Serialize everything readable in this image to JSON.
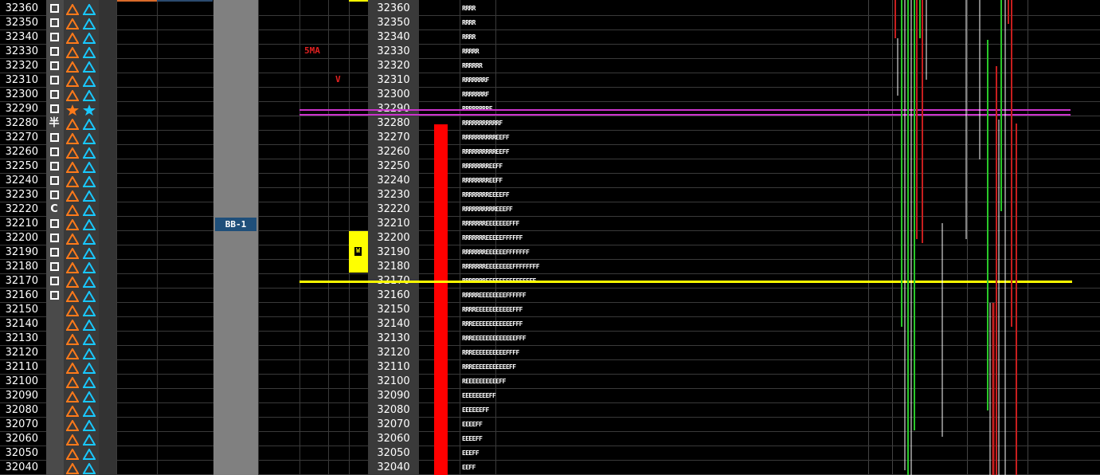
{
  "ladder": {
    "prices": [
      "32360",
      "32350",
      "32340",
      "32330",
      "32320",
      "32310",
      "32300",
      "32290",
      "32280",
      "32270",
      "32260",
      "32250",
      "32240",
      "32230",
      "32220",
      "32210",
      "32200",
      "32190",
      "32180",
      "32170",
      "32160",
      "32150",
      "32140",
      "32130",
      "32120",
      "32110",
      "32100",
      "32090",
      "32080",
      "32070",
      "32060",
      "32050",
      "32040"
    ],
    "col1_marks": [
      "box",
      "box",
      "box",
      "box",
      "box",
      "box",
      "box",
      "box",
      "kanji",
      "box",
      "box",
      "box",
      "box",
      "box",
      "C",
      "box",
      "box",
      "box",
      "box",
      "box",
      "box",
      "",
      "",
      "",
      "",
      "",
      "",
      "",
      "",
      "",
      "",
      "",
      ""
    ],
    "col2_marks": [
      "tri",
      "tri",
      "tri",
      "tri",
      "tri",
      "tri",
      "tri",
      "star",
      "tri",
      "tri",
      "tri",
      "tri",
      "tri",
      "tri",
      "tri",
      "tri",
      "tri",
      "tri",
      "tri",
      "tri",
      "tri",
      "tri",
      "tri",
      "tri",
      "tri",
      "tri",
      "tri",
      "tri",
      "tri",
      "tri",
      "tri",
      "tri",
      "tri"
    ],
    "col3_marks": [
      "tri",
      "tri",
      "tri",
      "tri",
      "tri",
      "tri",
      "tri",
      "star",
      "tri",
      "tri",
      "tri",
      "tri",
      "tri",
      "tri",
      "tri",
      "tri",
      "tri",
      "tri",
      "tri",
      "tri",
      "tri",
      "tri",
      "tri",
      "tri",
      "tri",
      "tri",
      "tri",
      "tri",
      "tri",
      "tri",
      "tri",
      "tri",
      "tri"
    ],
    "kanji_text": "半",
    "c_text": "C"
  },
  "tpo_profile": [
    "RRRR",
    "RRRR",
    "RRRR",
    "RRRRR",
    "RRRRRR",
    "RRRRRRRF",
    "RRRRRRRF",
    "RRRRRRRRF",
    "RRRRRRRRRRRF",
    "RRRRRRRRRREEFF",
    "RRRRRRRRRREEFF",
    "RRRRRRRREEFF",
    "RRRRRRRREEFF",
    "RRRRRRRREEEEFF",
    "RRRRRRRRRREEEFF",
    "RRRRRRREEEEEEEFFF",
    "RRRRRRREEEEEFFFFFF",
    "RRRRRRREEEEEEFFFFFFF",
    "RRRRRRREEEEEEEEFFFFFFFF",
    "RRRRRRREEEEEEEEFFFFFFF",
    "RRRRREEEEEEEEFFFFFF",
    "RRRREEEEEEEEEEEFFF",
    "RRREEEEEEEEEEEEFFF",
    "RRREEEEEEEEEEEEEFFF",
    "RRREEEEEEEEEEFFFF",
    "RRREEEEEEEEEEEFF",
    "REEEEEEEEEEFF",
    "EEEEEEEEFF",
    "EEEEEEFF",
    "EEEEFF",
    "EEEEFF",
    "EEEFF",
    "EEFF"
  ],
  "labels": {
    "sma": "5MA",
    "v_mark": "V",
    "bb": "BB-1",
    "w_mark": "W"
  },
  "colors": {
    "background": "#000000",
    "text": "#ffffff",
    "triangle_orange": "#ff7a1a",
    "triangle_cyan": "#19c8ff",
    "volume_bar": "#ff0000",
    "line_magenta": "#cc33cc",
    "line_yellow": "#ffff00",
    "bb_band": "#808080",
    "bb_label_bg": "#1f4f7a",
    "accent_orange_strip": "#d96a2a",
    "accent_blue_strip": "#2b4a6e"
  }
}
